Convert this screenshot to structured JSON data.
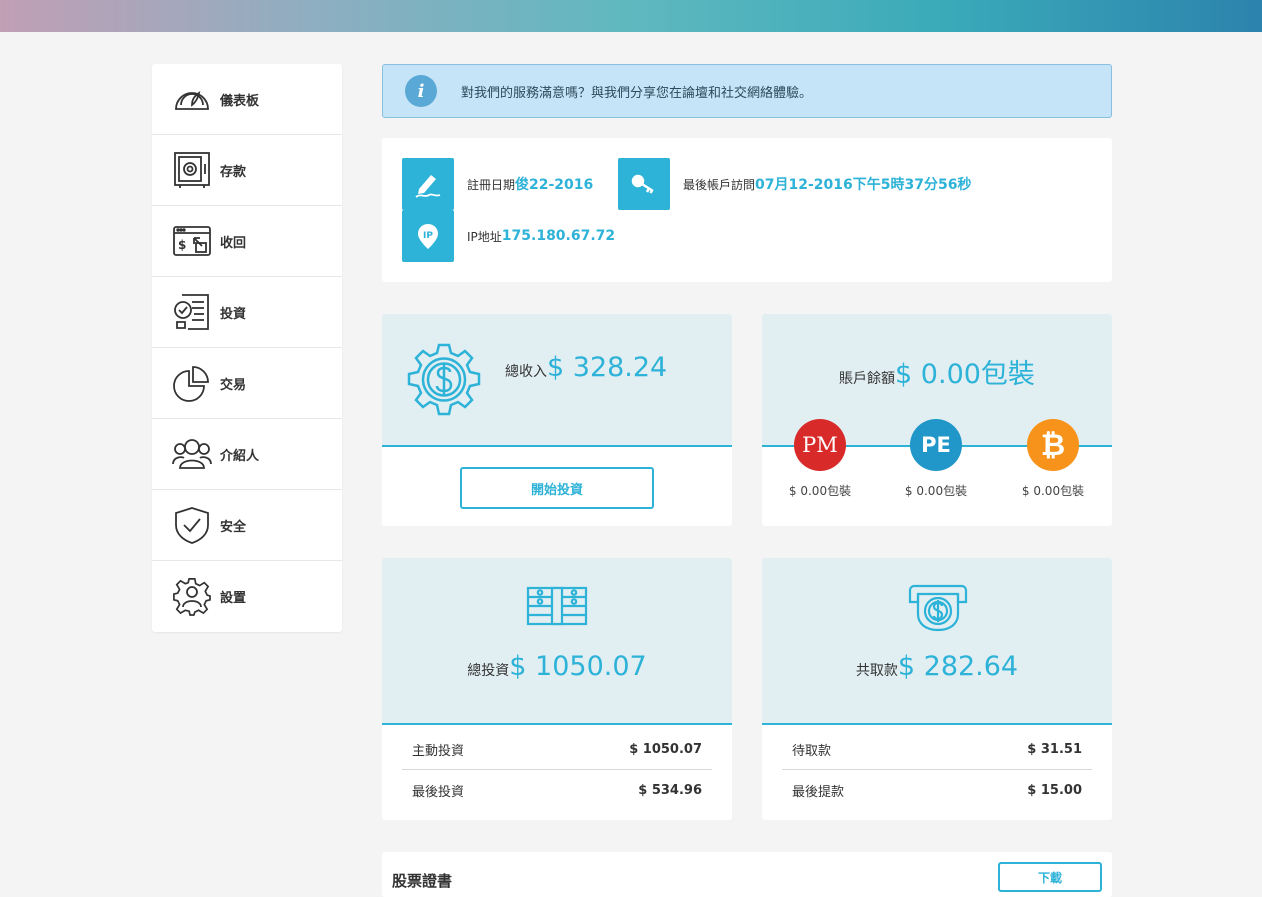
{
  "sidebar": {
    "items": [
      {
        "label": "儀表板",
        "icon": "dashboard-gauge-icon"
      },
      {
        "label": "存款",
        "icon": "safe-icon"
      },
      {
        "label": "收回",
        "icon": "withdraw-icon"
      },
      {
        "label": "投資",
        "icon": "invest-checklist-icon"
      },
      {
        "label": "交易",
        "icon": "pie-chart-icon"
      },
      {
        "label": "介紹人",
        "icon": "referral-users-icon"
      },
      {
        "label": "安全",
        "icon": "shield-check-icon"
      },
      {
        "label": "設置",
        "icon": "settings-gear-user-icon"
      }
    ]
  },
  "banner": {
    "icon": "info-icon",
    "text": "對我們的服務滿意嗎？與我們分享您在論壇和社交網絡體驗。"
  },
  "account": {
    "registration_label": "註冊日期",
    "registration_value": "俊22-2016",
    "last_access_label": "最後帳戶訪問",
    "last_access_value": "07月12-2016下午5時37分56秒",
    "ip_label": "IP地址",
    "ip_value": "175.180.67.72"
  },
  "income": {
    "label": "總收入",
    "value": "$ 328.24",
    "button": "開始投資"
  },
  "balance": {
    "label": "賬戶餘額",
    "value": "$ 0.00包裝",
    "coins": [
      {
        "symbol": "PM",
        "amount": "$ 0.00包裝",
        "color": "#d92a2a"
      },
      {
        "symbol": "PE",
        "amount": "$ 0.00包裝",
        "color": "#2197c9"
      },
      {
        "symbol": "₿",
        "amount": "$ 0.00包裝",
        "color": "#f7931a"
      }
    ]
  },
  "investment": {
    "label": "總投資",
    "value": "$ 1050.07",
    "rows": [
      {
        "label": "主動投資",
        "value": "$ 1050.07"
      },
      {
        "label": "最後投資",
        "value": "$ 534.96"
      }
    ]
  },
  "withdrawal": {
    "label": "共取款",
    "value": "$ 282.64",
    "rows": [
      {
        "label": "待取款",
        "value": "$ 31.51"
      },
      {
        "label": "最後提款",
        "value": "$ 15.00"
      }
    ]
  },
  "certificate": {
    "title": "股票證書",
    "button": "下載"
  },
  "colors": {
    "accent": "#2db2d8",
    "card_top": "#e1eef2",
    "banner_bg": "#c6e4f8"
  }
}
